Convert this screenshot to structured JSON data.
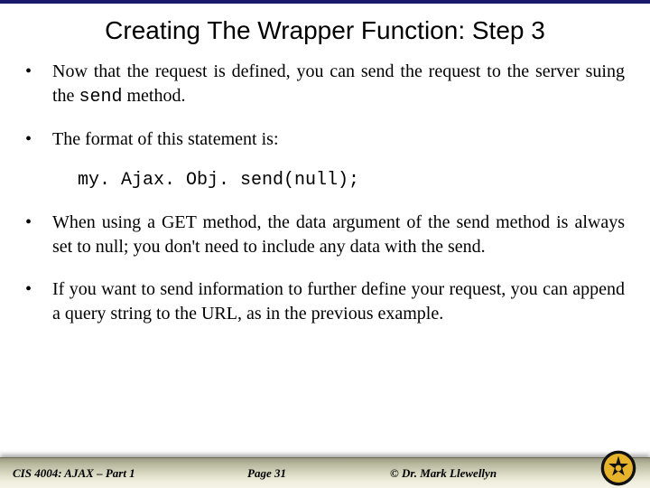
{
  "title": "Creating The Wrapper Function: Step 3",
  "bullets": {
    "b1_a": "Now that the request is defined, you can send the request to the server suing the ",
    "b1_code": "send",
    "b1_b": " method.",
    "b2": "The format of this statement is:",
    "code_line": "my. Ajax. Obj. send(null);",
    "b3": "When using a GET method, the data argument of the send method is always set to null; you don't need to include any data with the send.",
    "b4": "If you want to send information to further define your request, you can append a query string to the URL, as in the previous example."
  },
  "footer": {
    "left": "CIS 4004: AJAX – Part 1",
    "center": "Page 31",
    "right": "© Dr. Mark Llewellyn"
  }
}
